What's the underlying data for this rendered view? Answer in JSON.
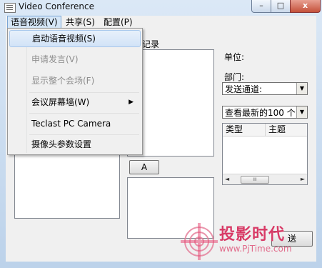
{
  "window": {
    "title": "Video Conference",
    "controls": {
      "minimize": "–",
      "maximize": "□",
      "close": "x"
    }
  },
  "menubar": [
    {
      "label": "语音视频(V)",
      "active": true
    },
    {
      "label": "共享(S)"
    },
    {
      "label": "配置(P)"
    }
  ],
  "dropdown": {
    "items": [
      {
        "label": "启动语音视频(S)",
        "state": "highlight"
      },
      {
        "label": "申请发言(V)",
        "state": "disabled"
      },
      {
        "label": "显示整个会场(F)",
        "state": "disabled"
      },
      {
        "label": "会议屏幕墙(W)",
        "submenu": true,
        "submenu_glyph": "▶"
      },
      {
        "label": "Teclast PC Camera"
      },
      {
        "label": "摄像头参数设置"
      }
    ]
  },
  "main": {
    "chat_label_partial": "话记录",
    "button_a": "A",
    "unit_label": "单位:",
    "dept_label": "部门:",
    "send_channel": "发送通道:",
    "latest_filter": "查看最新的100 个",
    "combo_arrow": "▼",
    "table": {
      "columns": [
        "类型",
        "主题"
      ]
    },
    "scroll": {
      "left": "◄",
      "right": "►",
      "thumb": "III"
    },
    "send_partial": "送"
  },
  "watermark": {
    "text": "投影时代",
    "url": "www.PjTime.com"
  }
}
